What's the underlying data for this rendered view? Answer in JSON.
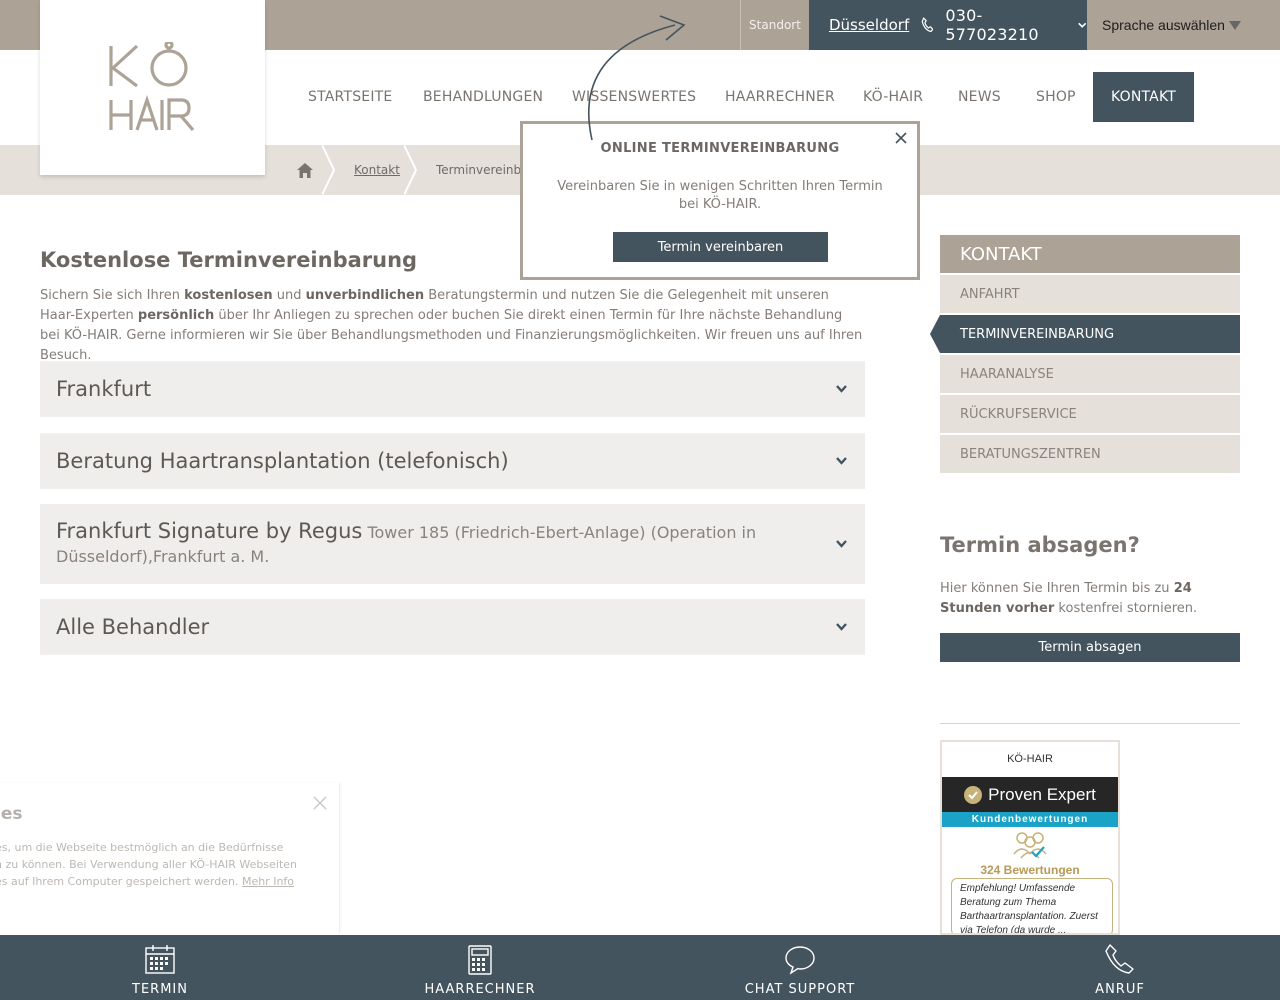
{
  "topbar": {
    "standort_label": "Standort",
    "city": "Düsseldorf",
    "phone": "030-577023210",
    "language": "Sprache auswählen"
  },
  "nav": {
    "items": [
      "STARTSEITE",
      "BEHANDLUNGEN",
      "WISSENSWERTES",
      "HAARRECHNER",
      "KÖ-HAIR",
      "NEWS",
      "SHOP",
      "KONTAKT"
    ],
    "active": "KONTAKT"
  },
  "breadcrumb": {
    "items": [
      "Kontakt",
      "Terminvereinbarung"
    ]
  },
  "content": {
    "title": "Kostenlose Terminvereinbarung",
    "intro": {
      "p1": "Sichern Sie sich Ihren ",
      "b1": "kostenlosen",
      "p2": " und ",
      "b2": "unverbindlichen",
      "p3": " Beratungstermin und nutzen Sie die Gelegenheit mit unseren Haar-Experten ",
      "b3": "persönlich",
      "p4": " über Ihr Anliegen zu sprechen oder buchen Sie direkt einen Termin für Ihre nächste Behandlung bei KÖ-HAIR. Gerne informieren wir Sie über Behandlungsmethoden und Finanzierungsmöglichkeiten. Wir freuen uns auf Ihren Besuch."
    },
    "accordion": [
      {
        "title": "Frankfurt",
        "sub": ""
      },
      {
        "title": "Beratung Haartransplantation (telefonisch)",
        "sub": ""
      },
      {
        "title": "Frankfurt Signature by Regus",
        "sub": "Tower 185 (Friedrich-Ebert-Anlage) (Operation in Düsseldorf),Frankfurt a. M."
      },
      {
        "title": "Alle Behandler",
        "sub": ""
      }
    ]
  },
  "sidebar": {
    "heading": "KONTAKT",
    "items": [
      "ANFAHRT",
      "TERMINVEREINBARUNG",
      "HAARANALYSE",
      "RÜCKRUFSERVICE",
      "BERATUNGSZENTREN"
    ],
    "active": "TERMINVEREINBARUNG",
    "cancel": {
      "title": "Termin absagen?",
      "t1": "Hier können Sie Ihren Termin bis zu ",
      "b1": "24 Stunden vorher",
      "t2": " kostenfrei stornieren.",
      "button": "Termin absagen"
    }
  },
  "proven_expert": {
    "brand": "KÖ-HAIR",
    "logo_text": "Proven Expert",
    "band": "Kundenbewertungen",
    "count": "324 Bewertungen",
    "quote": "Empfehlung! Umfassende Beratung zum Thema Barthaartransplantation. Zuerst via Telefon (da wurde ..."
  },
  "popup": {
    "title": "ONLINE TERMINVEREINBARUNG",
    "text": "Vereinbaren Sie in wenigen Schritten Ihren Termin bei KÖ-HAIR.",
    "button": "Termin vereinbaren"
  },
  "cookie": {
    "title_fragment": "ies",
    "line1": "es, um die Webseite bestmöglich an die Bedürfnisse",
    "line2": "n zu können. Bei Verwendung aller KÖ-HAIR Webseiten",
    "line3": "es auf Ihrem Computer gespeichert werden. ",
    "link": "Mehr Info"
  },
  "bottombar": {
    "items": [
      "TERMIN",
      "HAARRECHNER",
      "CHAT SUPPORT",
      "ANRUF"
    ]
  },
  "colors": {
    "taupe": "#ada296",
    "slate": "#43545f",
    "beige": "#e5e0da",
    "accordion_bg": "#f0eeec",
    "gold": "#b79a55",
    "proven_blue": "#1aa3c7"
  }
}
